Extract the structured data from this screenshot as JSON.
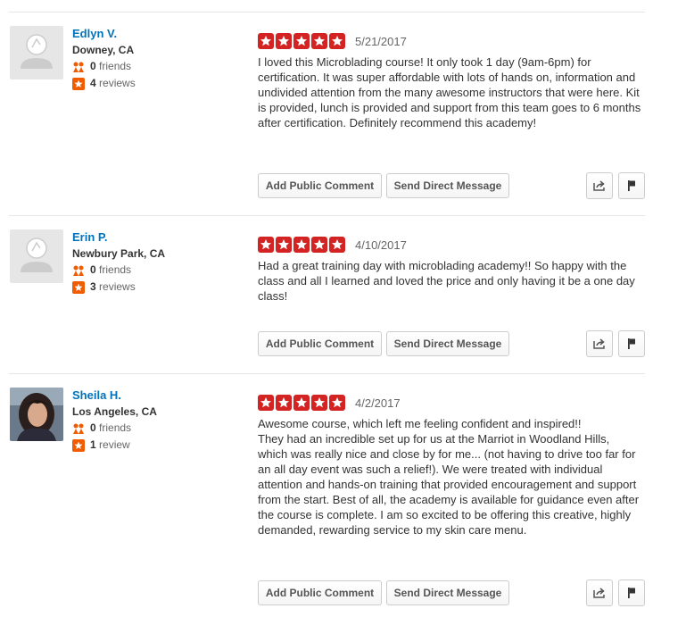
{
  "reviews": [
    {
      "user": {
        "name": "Edlyn V.",
        "location": "Downey, CA",
        "friends": "0",
        "friends_label": "friends",
        "reviews": "4",
        "reviews_label": "reviews",
        "avatar": "default-avatar"
      },
      "rating": 5,
      "date": "5/21/2017",
      "text": "I loved this Microblading course! It only took 1 day (9am-6pm) for certification. It was super affordable with lots of hands on, information and undivided attention from the many awesome instructors that were here. Kit is provided, lunch is provided and support from this team goes to 6 months after certification. Definitely recommend this academy!",
      "actions": {
        "comment": "Add Public Comment",
        "message": "Send Direct Message"
      }
    },
    {
      "user": {
        "name": "Erin P.",
        "location": "Newbury Park, CA",
        "friends": "0",
        "friends_label": "friends",
        "reviews": "3",
        "reviews_label": "reviews",
        "avatar": "default-avatar"
      },
      "rating": 5,
      "date": "4/10/2017",
      "text": "Had a great training day with microblading academy!! So happy with the class and all I learned and loved the price and only having it be a one day class!",
      "actions": {
        "comment": "Add Public Comment",
        "message": "Send Direct Message"
      }
    },
    {
      "user": {
        "name": "Sheila H.",
        "location": "Los Angeles, CA",
        "friends": "0",
        "friends_label": "friends",
        "reviews": "1",
        "reviews_label": "review",
        "avatar": "photo-avatar"
      },
      "rating": 5,
      "date": "4/2/2017",
      "text": "Awesome course, which left me feeling confident and inspired!!\n They had an incredible set up for us at the Marriot in Woodland Hills, which was really nice and close by for me... (not having to drive too far for an all day event was such a relief!).  We were treated with individual attention and hands-on training that provided encouragement and support from the start.  Best of all, the academy is available for guidance even after the course is complete.  I am so excited to be offering this creative, highly demanded, rewarding service to my skin care menu.",
      "actions": {
        "comment": "Add Public Comment",
        "message": "Send Direct Message"
      }
    }
  ],
  "colors": {
    "star": "#d32323",
    "link": "#0073bb",
    "friends_icon": "#f15c00",
    "review_icon": "#f15c00"
  },
  "icons": {
    "friends": "friends-icon",
    "reviews": "star-badge-icon",
    "share": "share-icon",
    "flag": "flag-icon"
  }
}
